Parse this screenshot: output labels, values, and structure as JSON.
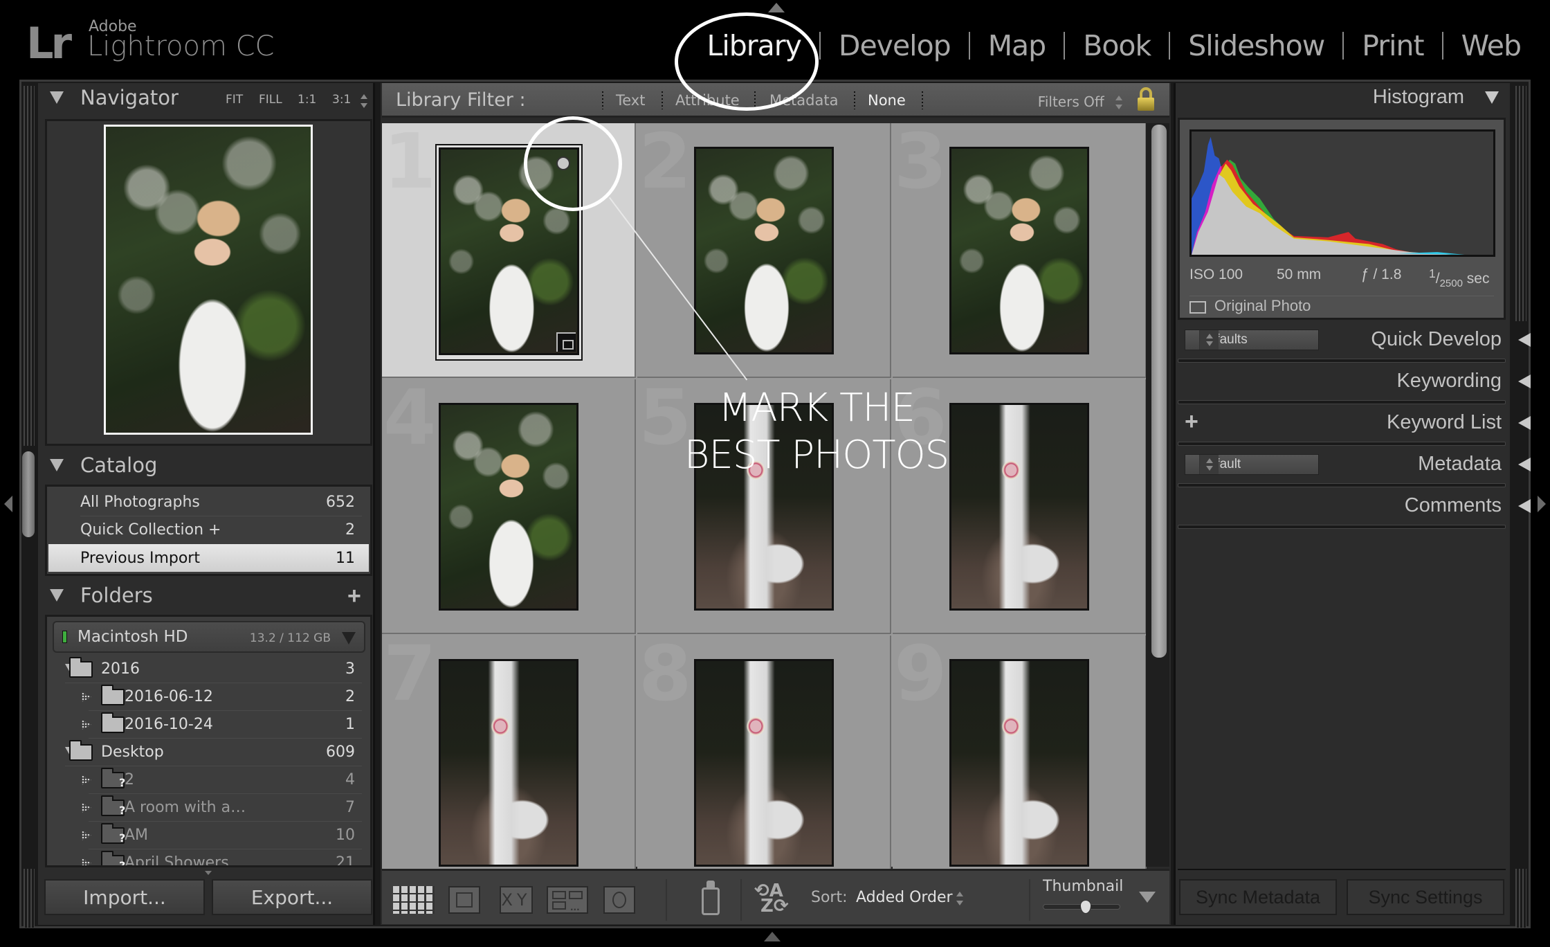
{
  "app": {
    "brand_abbrev": "Lr",
    "brand_company": "Adobe",
    "brand_name": "Lightroom CC"
  },
  "modules": [
    {
      "label": "Library",
      "active": true
    },
    {
      "label": "Develop",
      "active": false
    },
    {
      "label": "Map",
      "active": false
    },
    {
      "label": "Book",
      "active": false
    },
    {
      "label": "Slideshow",
      "active": false
    },
    {
      "label": "Print",
      "active": false
    },
    {
      "label": "Web",
      "active": false
    }
  ],
  "left_panel": {
    "navigator": {
      "title": "Navigator",
      "zoom_options": [
        "FIT",
        "FILL",
        "1:1",
        "3:1"
      ]
    },
    "catalog": {
      "title": "Catalog",
      "items": [
        {
          "label": "All Photographs",
          "count": "652",
          "selected": false
        },
        {
          "label": "Quick Collection +",
          "count": "2",
          "selected": false
        },
        {
          "label": "Previous Import",
          "count": "11",
          "selected": true
        }
      ]
    },
    "folders": {
      "title": "Folders",
      "add_icon": "plus-icon",
      "volume": {
        "name": "Macintosh HD",
        "usage": "13.2 / 112 GB",
        "status_color": "#3fae3f"
      },
      "items": [
        {
          "label": "2016",
          "count": "3",
          "level": 0,
          "expanded": true,
          "missing": false
        },
        {
          "label": "2016-06-12",
          "count": "2",
          "level": 1,
          "expanded": false,
          "missing": false
        },
        {
          "label": "2016-10-24",
          "count": "1",
          "level": 1,
          "expanded": false,
          "missing": false
        },
        {
          "label": "Desktop",
          "count": "609",
          "level": 0,
          "expanded": true,
          "missing": false
        },
        {
          "label": "2",
          "count": "4",
          "level": 1,
          "expanded": false,
          "missing": true
        },
        {
          "label": "A room with a…",
          "count": "7",
          "level": 1,
          "expanded": false,
          "missing": true
        },
        {
          "label": "AM",
          "count": "10",
          "level": 1,
          "expanded": false,
          "missing": true
        },
        {
          "label": "April Showers",
          "count": "21",
          "level": 1,
          "expanded": false,
          "missing": true
        }
      ]
    },
    "buttons": {
      "import": "Import...",
      "export": "Export..."
    }
  },
  "filter_bar": {
    "label": "Library Filter :",
    "options": [
      {
        "label": "Text",
        "active": false
      },
      {
        "label": "Attribute",
        "active": false
      },
      {
        "label": "Metadata",
        "active": false
      },
      {
        "label": "None",
        "active": true
      }
    ],
    "preset": "Filters Off"
  },
  "grid": {
    "cells": [
      {
        "number": "1",
        "subject": "portrait",
        "selected": true,
        "badges": [
          "unsaved-dot",
          "stack"
        ]
      },
      {
        "number": "2",
        "subject": "portrait",
        "selected": false,
        "badges": []
      },
      {
        "number": "3",
        "subject": "portrait",
        "selected": false,
        "badges": []
      },
      {
        "number": "4",
        "subject": "portrait",
        "selected": false,
        "badges": []
      },
      {
        "number": "5",
        "subject": "dress",
        "selected": false,
        "badges": []
      },
      {
        "number": "6",
        "subject": "dress",
        "selected": false,
        "badges": []
      },
      {
        "number": "7",
        "subject": "dress",
        "selected": false,
        "badges": []
      },
      {
        "number": "8",
        "subject": "dress",
        "selected": false,
        "badges": []
      },
      {
        "number": "9",
        "subject": "dress",
        "selected": false,
        "badges": []
      }
    ],
    "overlay_text_line1": "MARK THE",
    "overlay_text_line2": "BEST PHOTOS"
  },
  "toolbar": {
    "view_buttons": [
      "grid-view",
      "loupe-view",
      "compare-view",
      "survey-view",
      "people-view"
    ],
    "compare_label": "XY",
    "sort_label": "Sort:",
    "sort_value": "Added Order",
    "thumbnail_label": "Thumbnail",
    "thumbnail_size": 0.55
  },
  "right_panel": {
    "histogram": {
      "title": "Histogram",
      "iso": "ISO 100",
      "focal_length": "50 mm",
      "aperture": "ƒ / 1.8",
      "shutter_num": "1",
      "shutter_den": "2500",
      "shutter_unit": "sec",
      "original_photo_label": "Original Photo",
      "original_photo_checked": false
    },
    "sections": [
      {
        "title": "Quick Develop",
        "preset": "Defaults"
      },
      {
        "title": "Keywording",
        "preset": null
      },
      {
        "title": "Keyword List",
        "preset": null,
        "has_add": true
      },
      {
        "title": "Metadata",
        "preset": "Default"
      },
      {
        "title": "Comments",
        "preset": null
      }
    ],
    "buttons": {
      "sync_metadata": "Sync Metadata",
      "sync_settings": "Sync Settings"
    }
  },
  "colors": {
    "background": "#000000",
    "panel": "#2c2c2c",
    "grid_cell": "#999999",
    "grid_cell_selected": "#d2d2d2",
    "lock": "#c9b24a"
  }
}
